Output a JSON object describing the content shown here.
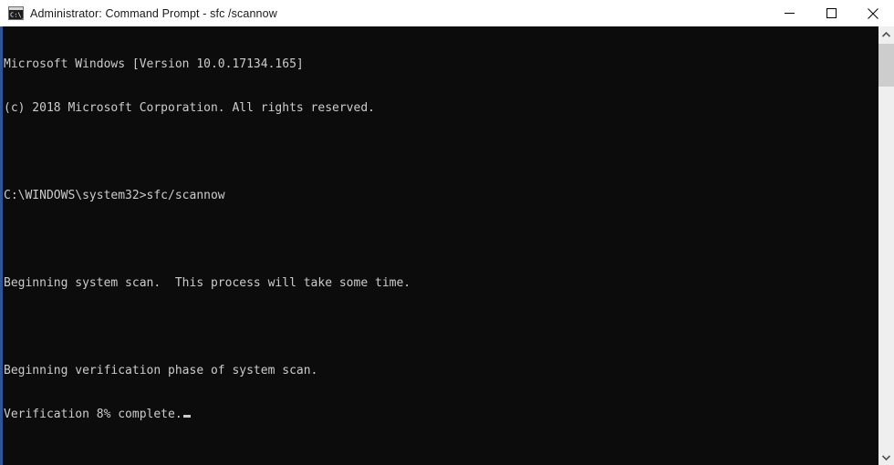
{
  "window": {
    "title": "Administrator: Command Prompt - sfc /scannow",
    "icon": "console-window-icon",
    "icon_text": "C:\\_",
    "titlebar_bg": "#ffffff",
    "title_color": "#1a1a1a"
  },
  "controls": {
    "minimize": {
      "name": "minimize-button",
      "glyph": "minimize-icon"
    },
    "maximize": {
      "name": "maximize-button",
      "glyph": "maximize-icon"
    },
    "close": {
      "name": "close-button",
      "glyph": "close-icon"
    }
  },
  "console": {
    "background": "#0c0c0c",
    "foreground": "#cccccc",
    "accent_edge": "#2b579a",
    "lines": [
      "Microsoft Windows [Version 10.0.17134.165]",
      "(c) 2018 Microsoft Corporation. All rights reserved.",
      "",
      "C:\\WINDOWS\\system32>sfc/scannow",
      "",
      "Beginning system scan.  This process will take some time.",
      "",
      "Beginning verification phase of system scan.",
      "Verification 8% complete."
    ],
    "cursor_visible": true,
    "progress_percent": 8,
    "command": "sfc/scannow",
    "prompt_path": "C:\\WINDOWS\\system32",
    "os_version": "10.0.17134.165",
    "copyright_year": "2018"
  },
  "scrollbar": {
    "track_color": "#efefef",
    "thumb_color": "#cdcdcd",
    "up_arrow": "chevron-up-icon",
    "down_arrow": "chevron-down-icon"
  }
}
